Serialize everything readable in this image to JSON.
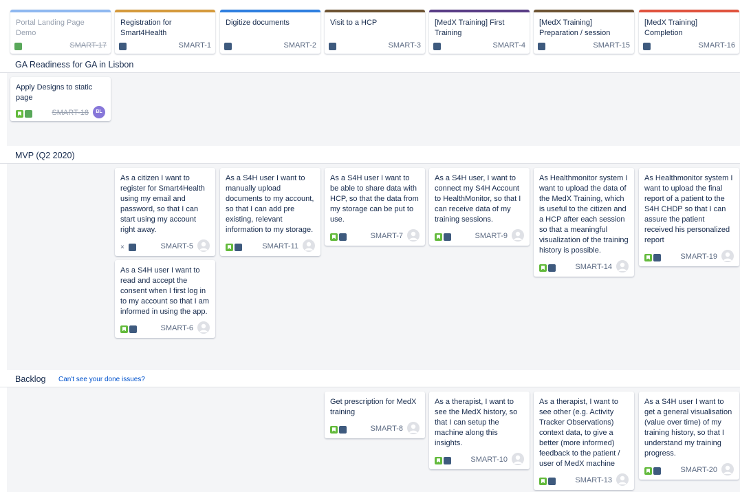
{
  "epics": [
    {
      "title": "Portal Landing Page Demo",
      "key": "SMART-17",
      "color": "#8fb8f0",
      "done": true
    },
    {
      "title": "Registration for Smart4Health",
      "key": "SMART-1",
      "color": "#d59a3c",
      "done": false
    },
    {
      "title": "Digitize documents",
      "key": "SMART-2",
      "color": "#2f7fe0",
      "done": false
    },
    {
      "title": "Visit to a HCP",
      "key": "SMART-3",
      "color": "#6e5433",
      "done": false
    },
    {
      "title": "[MedX Training] First Training",
      "key": "SMART-4",
      "color": "#5a3d86",
      "done": false
    },
    {
      "title": "[MedX Training] Preparation / session",
      "key": "SMART-15",
      "color": "#6e5433",
      "done": false
    },
    {
      "title": "[MedX Training] Completion",
      "key": "SMART-16",
      "color": "#e0533e",
      "done": false
    }
  ],
  "lanes": {
    "ga": {
      "name": "GA Readiness for GA in Lisbon",
      "cards": [
        {
          "text": "Apply Designs to static page",
          "key": "SMART-18",
          "avatar": "BL"
        }
      ]
    },
    "mvp": {
      "name": "MVP (Q2 2020)",
      "cards": [
        {
          "text": "As a citizen I want to register for Smart4Health using my email and password, so that I can start using my account right away.",
          "key": "SMART-5"
        },
        {
          "text": "As a S4H user I want to read and accept the consent when I first log in to my account so that I am informed in using the app.",
          "key": "SMART-6"
        },
        {
          "text": "As a S4H user I want to manually upload documents to my account, so that I can add pre existing, relevant information to my storage.",
          "key": "SMART-11"
        },
        {
          "text": "As a S4H user I want to be able to share data with HCP, so that the data from my storage can be put to use.",
          "key": "SMART-7"
        },
        {
          "text": "As a S4H user, I want to connect my S4H Account to HealthMonitor, so that I can receive data of my training sessions.",
          "key": "SMART-9"
        },
        {
          "text": "As Healthmonitor system I want to upload the data of the MedX Training, which is useful to the citizen and a HCP after each session so that a meaningful visualization of the training history is possible.",
          "key": "SMART-14"
        },
        {
          "text": "As Healthmonitor system I want to upload the final report of a patient to the S4H CHDP so that I can assure the patient received his personalized report",
          "key": "SMART-19"
        }
      ]
    },
    "backlog": {
      "name": "Backlog",
      "link": "Can't see your done issues?",
      "cards": [
        {
          "text": "Get prescription for MedX training",
          "key": "SMART-8"
        },
        {
          "text": "As a therapist, I want to see the MedX history, so that I can setup the machine along this insights.",
          "key": "SMART-10"
        },
        {
          "text": "As a therapist, I want to see other (e.g. Activity Tracker Observations) context data, to give a better (more informed) feedback to the patient / user of MedX machine",
          "key": "SMART-13"
        },
        {
          "text": "As a S4H user I want to get a general visualisation (value over time) of my training history, so that I understand my training progress.",
          "key": "SMART-20"
        }
      ]
    }
  }
}
